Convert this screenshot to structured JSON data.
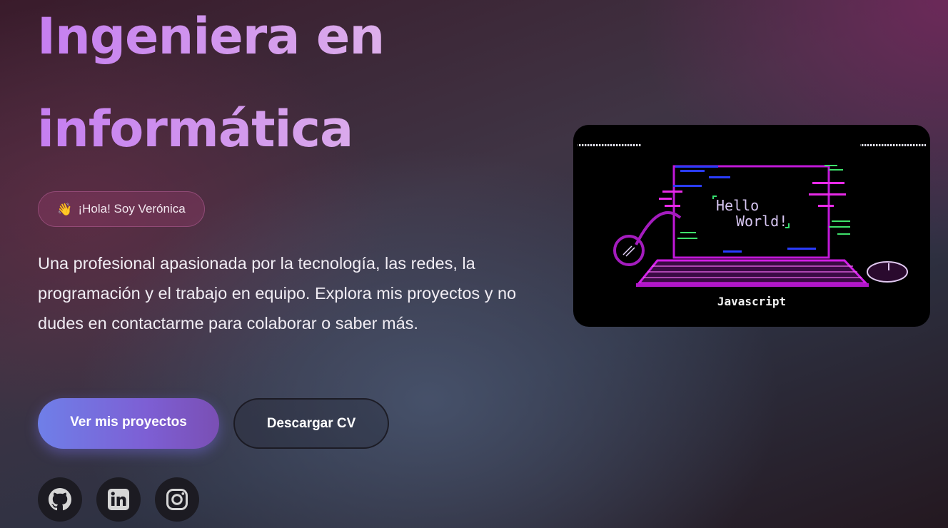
{
  "hero": {
    "title_line1": "Ingeniera en",
    "title_line2": "informática",
    "greeting": "¡Hola! Soy Verónica",
    "greeting_icon": "wave-hand-icon",
    "intro": "Una profesional apasionada por la tecnología, las redes, la programación y el trabajo en equipo. Explora mis proyectos y no dudes en contactarme para colaborar o saber más."
  },
  "actions": {
    "primary_label": "Ver mis proyectos",
    "secondary_label": "Descargar CV"
  },
  "social": [
    {
      "name": "github-icon"
    },
    {
      "name": "linkedin-icon"
    },
    {
      "name": "instagram-icon"
    }
  ],
  "card": {
    "screen_line1": "Hello",
    "screen_line2": "World!",
    "label": "Javascript"
  },
  "colors": {
    "accent_gradient_start": "#c57ef0",
    "accent_gradient_end": "#ecd0ee",
    "primary_button_start": "#6f7fe8",
    "primary_button_end": "#7a4fb4",
    "neon_magenta": "#d21ee8"
  }
}
